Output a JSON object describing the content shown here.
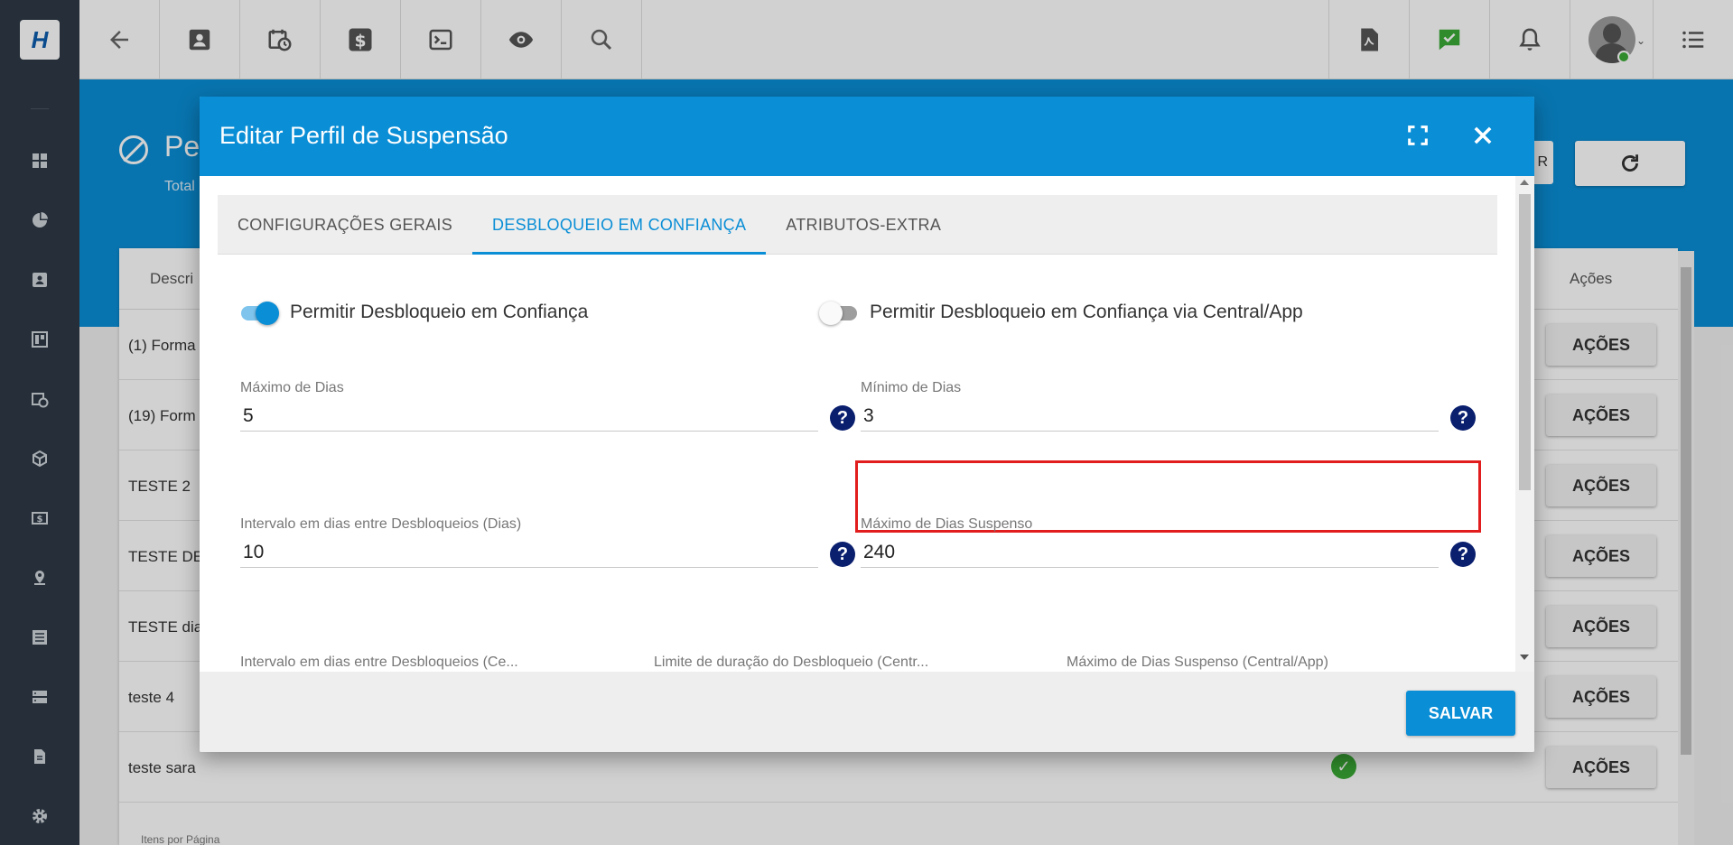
{
  "topbar": {
    "logo_text": "H",
    "left_icons": [
      "arrow-left-icon",
      "contact-card-icon",
      "calendar-clock-icon",
      "dollar-icon",
      "terminal-icon",
      "eye-icon",
      "search-icon"
    ],
    "right_icons": [
      "pdf-icon",
      "chat-check-icon",
      "bell-icon"
    ],
    "notification_color": "#3aaa35"
  },
  "sidebar": {
    "icons": [
      "dashboard-icon",
      "pie-chart-icon",
      "contact-icon",
      "board-icon",
      "calendar-clock-icon",
      "cube-icon",
      "money-icon",
      "map-pin-icon",
      "list-icon",
      "server-icon",
      "document-icon",
      "gear-icon"
    ]
  },
  "background_page": {
    "title": "Pe",
    "subtitle": "Total",
    "partial_button_text": "R",
    "col_description": "Descri",
    "col_actions": "Ações",
    "rows": [
      {
        "description": "(1) Forma",
        "action": "AÇÕES",
        "check": false
      },
      {
        "description": "(19) Form",
        "action": "AÇÕES",
        "check": false
      },
      {
        "description": "TESTE 2",
        "action": "AÇÕES",
        "check": false
      },
      {
        "description": "TESTE DE",
        "action": "AÇÕES",
        "check": false
      },
      {
        "description": "TESTE dia",
        "action": "AÇÕES",
        "check": false
      },
      {
        "description": "teste 4",
        "action": "AÇÕES",
        "check": false
      },
      {
        "description": "teste sara",
        "action": "AÇÕES",
        "check": true
      }
    ],
    "footer_label": "Itens por Página"
  },
  "modal": {
    "title": "Editar Perfil de Suspensão",
    "tabs": [
      {
        "label": "CONFIGURAÇÕES GERAIS",
        "active": false
      },
      {
        "label": "DESBLOQUEIO EM CONFIANÇA",
        "active": true
      },
      {
        "label": "ATRIBUTOS-EXTRA",
        "active": false
      }
    ],
    "toggles": [
      {
        "label": "Permitir Desbloqueio em Confiança",
        "on": true
      },
      {
        "label": "Permitir Desbloqueio em Confiança via Central/App",
        "on": false
      }
    ],
    "fields": {
      "max_dias": {
        "label": "Máximo de Dias",
        "value": "5"
      },
      "min_dias": {
        "label": "Mínimo de Dias",
        "value": "3"
      },
      "intervalo": {
        "label": "Intervalo em dias entre Desbloqueios (Dias)",
        "value": "10"
      },
      "max_suspenso": {
        "label": "Máximo de Dias Suspenso",
        "value": "240"
      },
      "intervalo_central": {
        "label": "Intervalo em dias entre Desbloqueios (Ce..."
      },
      "limite_central": {
        "label": "Limite de duração do Desbloqueio (Centr..."
      },
      "max_suspenso_central": {
        "label": "Máximo de Dias Suspenso (Central/App)"
      }
    },
    "help_glyph": "?",
    "save_label": "SALVAR"
  },
  "colors": {
    "primary": "#0a8ed6",
    "sidebar": "#2f3a46",
    "help_icon": "#0a1f6e",
    "highlight": "#e21d1d",
    "success": "#3aaa35"
  }
}
